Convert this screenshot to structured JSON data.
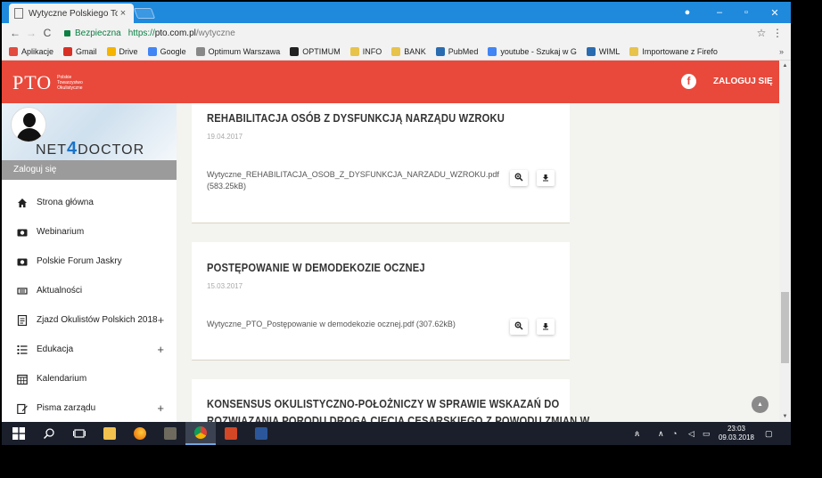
{
  "browser": {
    "tab_title": "Wytyczne Polskiego Tov",
    "tab_close": "×",
    "win_user": "●",
    "win_min": "–",
    "win_max": "▫",
    "win_close": "✕",
    "nav_back": "←",
    "nav_forward": "→",
    "nav_reload": "C",
    "secure_label": "Bezpieczna",
    "url_proto": "https://",
    "url_host": "pto.com.pl",
    "url_path": "/wytyczne",
    "star": "☆",
    "menu": "⋮"
  },
  "bookmarks": {
    "items": [
      {
        "label": "Aplikacje",
        "color": "#e34b3d"
      },
      {
        "label": "Gmail",
        "color": "#d93025"
      },
      {
        "label": "Drive",
        "color": "#f4b400"
      },
      {
        "label": "Google",
        "color": "#4285f4"
      },
      {
        "label": "Optimum Warszawa",
        "color": "#888888"
      },
      {
        "label": "OPTIMUM",
        "color": "#222222"
      },
      {
        "label": "INFO",
        "color": "#e8c34a"
      },
      {
        "label": "BANK",
        "color": "#e8c34a"
      },
      {
        "label": "PubMed",
        "color": "#2b6cb0"
      },
      {
        "label": "youtube - Szukaj w G",
        "color": "#4285f4"
      },
      {
        "label": "WIML",
        "color": "#2b6cb0"
      },
      {
        "label": "Importowane z Firefo",
        "color": "#e8c34a"
      }
    ],
    "more": "»"
  },
  "site": {
    "logo_mark": "PTO",
    "logo_text": "Polskie Towarzystwo Okulistyczne",
    "fb": "f",
    "login": "ZALOGUJ SIĘ"
  },
  "sidebar": {
    "brand_pre": "NET",
    "brand_four": "4",
    "brand_post": "DOCTOR",
    "login": "Zaloguj się",
    "items": [
      {
        "label": "Strona główna",
        "plus": ""
      },
      {
        "label": "Webinarium",
        "plus": ""
      },
      {
        "label": "Polskie Forum Jaskry",
        "plus": ""
      },
      {
        "label": "Aktualności",
        "plus": ""
      },
      {
        "label": "Zjazd Okulistów Polskich 2018",
        "plus": "+"
      },
      {
        "label": "Edukacja",
        "plus": "+"
      },
      {
        "label": "Kalendarium",
        "plus": ""
      },
      {
        "label": "Pisma zarządu",
        "plus": "+"
      }
    ]
  },
  "cards": [
    {
      "title": "REHABILITACJA OSÓB Z DYSFUNKCJĄ NARZĄDU WZROKU",
      "date": "19.04.2017",
      "file": "Wytyczne_REHABILITACJA_OSOB_Z_DYSFUNKCJA_NARZADU_WZROKU.pdf (583.25kB)"
    },
    {
      "title": "POSTĘPOWANIE W DEMODEKOZIE OCZNEJ",
      "date": "15.03.2017",
      "file": "Wytyczne_PTO_Postępowanie w demodekozie ocznej.pdf (307.62kB)"
    },
    {
      "title": "KONSENSUS OKULISTYCZNO-POŁOŻNICZY W SPRAWIE WSKAZAŃ DO",
      "title2": "ROZWIĄZANIA PORODU DROGĄ CIĘCIA CESARSKIEGO Z POWODU ZMIAN W"
    }
  ],
  "buttons": {
    "zoom": "⚲",
    "download": "⤓"
  },
  "scroll": {
    "up": "▲",
    "down": "▼",
    "to_top": "▲"
  },
  "taskbar": {
    "start": "⊞",
    "search": "⚲",
    "taskview": "▭",
    "tray_person": "ጰ",
    "tray_caret": "∧",
    "tray_wifi": "◔",
    "tray_sound": "◁",
    "tray_battery": "▭",
    "time": "23:03",
    "date": "09.03.2018",
    "notif": "▢"
  }
}
